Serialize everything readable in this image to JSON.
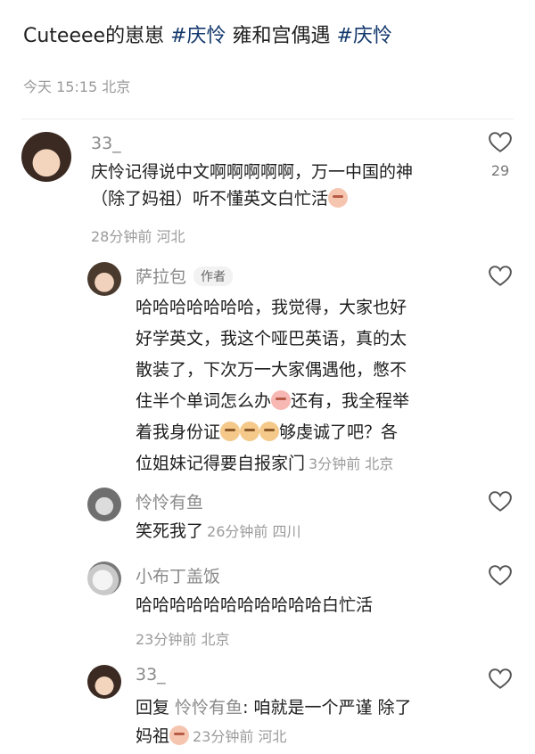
{
  "post": {
    "title_pre": "Cuteeee的崽崽 ",
    "tag1": "#庆怜",
    "title_mid": "  雍和宫偶遇 ",
    "tag2": "#庆怜",
    "meta": "今天 15:15 北京"
  },
  "comments": [
    {
      "name": "33_",
      "lines": [
        "庆怜记得说中文啊啊啊啊啊，万一中国的神",
        "（除了妈祖）听不懂英文白忙活"
      ],
      "emoji": "tongue-face",
      "meta": "28分钟前  河北",
      "likes": "29"
    },
    {
      "name": "萨拉包",
      "badge": "作者",
      "lines": [
        "哈哈哈哈哈哈哈，我觉得，大家也好",
        "好学英文，我这个哑巴英语，真的太",
        "散装了，下次万一大家偶遇他，憋不",
        "住半个单词怎么办",
        "着我身份证",
        "位姐妹记得要自报家门"
      ],
      "line4_tail": "还有，我全程举",
      "line5_tail": "够虔诚了吧？各",
      "meta": "3分钟前  北京"
    },
    {
      "name": "怜怜有鱼",
      "text": "笑死我了",
      "meta": "26分钟前  四川"
    },
    {
      "name": "小布丁盖饭",
      "text": "哈哈哈哈哈哈哈哈哈哈哈白忙活",
      "meta": "23分钟前  北京"
    },
    {
      "name": "33_",
      "reply_label": "回复 ",
      "reply_to": "怜怜有鱼",
      "reply_text": ": 咱就是一个严谨 除了",
      "line2": "妈祖",
      "meta": "23分钟前  河北"
    }
  ],
  "icons": {
    "like": "heart-outline-icon"
  },
  "colors": {
    "tag": "#13386c",
    "meta": "#9b9b9b",
    "name": "#8a8a8a"
  }
}
